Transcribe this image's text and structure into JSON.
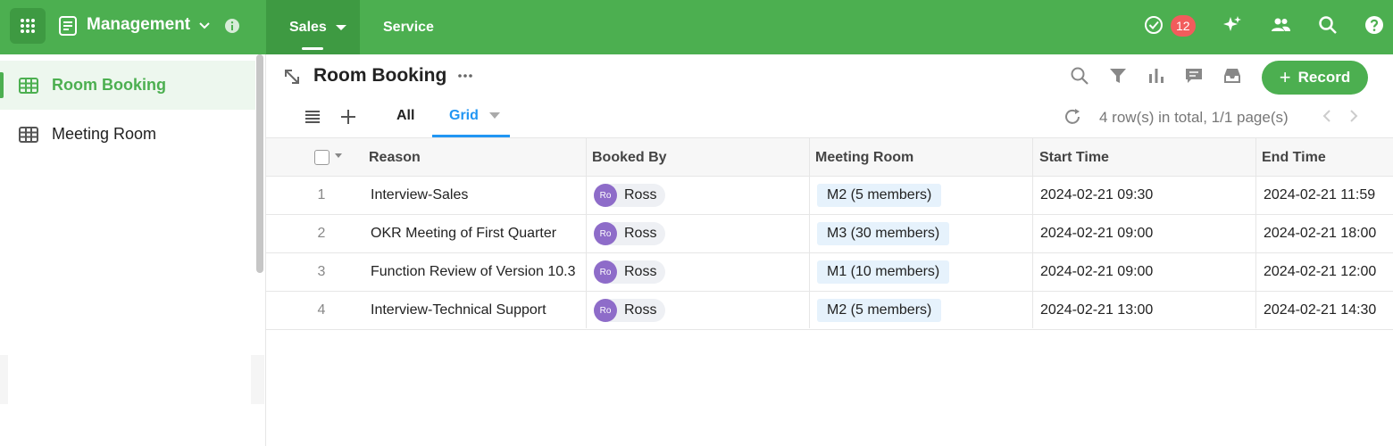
{
  "app": {
    "name": "Management",
    "tabs": [
      {
        "label": "Sales",
        "active": true
      },
      {
        "label": "Service",
        "active": false
      }
    ],
    "notification_count": "12",
    "accent_color": "#4caf50"
  },
  "sidebar": {
    "items": [
      {
        "label": "Room Booking",
        "icon": "grid-table-icon",
        "active": true
      },
      {
        "label": "Meeting Room",
        "icon": "grid-table-icon",
        "active": false
      }
    ]
  },
  "page": {
    "title": "Room Booking",
    "record_button": "Record",
    "views": [
      {
        "label": "All",
        "active": false
      },
      {
        "label": "Grid",
        "active": true
      }
    ],
    "row_info": "4 row(s) in total, 1/1 page(s)"
  },
  "table": {
    "columns": [
      "Reason",
      "Booked By",
      "Meeting Room",
      "Start Time",
      "End Time"
    ],
    "rows": [
      {
        "num": "1",
        "reason": "Interview-Sales",
        "booked_by": "Ross",
        "avatar": "Ro",
        "room": "M2 (5 members)",
        "start": "2024-02-21 09:30",
        "end": "2024-02-21 11:59"
      },
      {
        "num": "2",
        "reason": "OKR Meeting of First Quarter",
        "booked_by": "Ross",
        "avatar": "Ro",
        "room": "M3 (30 members)",
        "start": "2024-02-21 09:00",
        "end": "2024-02-21 18:00"
      },
      {
        "num": "3",
        "reason": "Function Review of Version 10.3",
        "booked_by": "Ross",
        "avatar": "Ro",
        "room": "M1 (10 members)",
        "start": "2024-02-21 09:00",
        "end": "2024-02-21 12:00"
      },
      {
        "num": "4",
        "reason": "Interview-Technical Support",
        "booked_by": "Ross",
        "avatar": "Ro",
        "room": "M2 (5 members)",
        "start": "2024-02-21 13:00",
        "end": "2024-02-21 14:30"
      }
    ]
  }
}
